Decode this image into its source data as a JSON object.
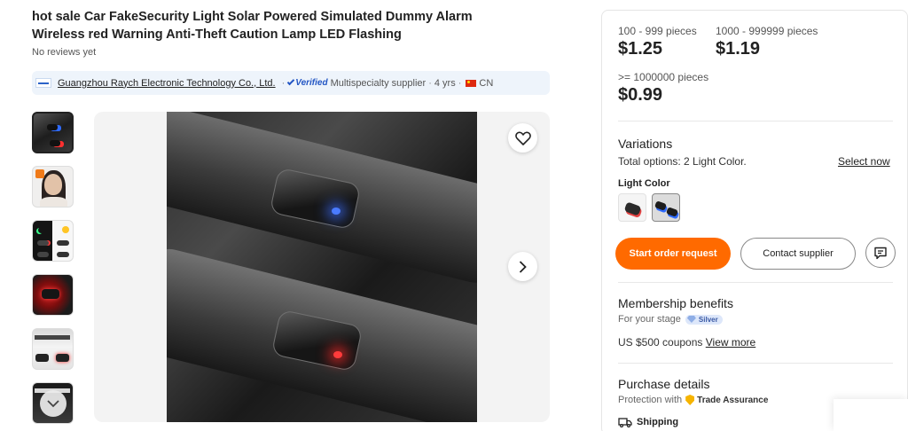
{
  "product": {
    "title": "hot sale Car FakeSecurity Light Solar Powered Simulated Dummy Alarm Wireless red Warning Anti-Theft Caution Lamp LED Flashing",
    "reviews": "No reviews yet"
  },
  "supplier": {
    "name": "Guangzhou Raych Electronic Technology Co., Ltd.",
    "verified": "Verified",
    "type": "Multispecialty supplier",
    "years": "4 yrs",
    "country": "CN"
  },
  "gallery": {
    "thumbnail_count": 6,
    "active_index": 0
  },
  "pricing": {
    "tiers": [
      {
        "qty": "100 - 999 pieces",
        "price": "$1.25"
      },
      {
        "qty": "1000 - 999999 pieces",
        "price": "$1.19"
      },
      {
        "qty": ">= 1000000 pieces",
        "price": "$0.99"
      }
    ]
  },
  "variations": {
    "title": "Variations",
    "total": "Total options: 2 Light Color.",
    "select_label": "Select now",
    "light_color_label": "Light Color"
  },
  "actions": {
    "order": "Start order request",
    "contact": "Contact supplier"
  },
  "membership": {
    "title": "Membership benefits",
    "stage": "For your stage",
    "level": "Silver",
    "coupons": "US $500 coupons",
    "view_more": "View more"
  },
  "purchase": {
    "title": "Purchase details",
    "protection": "Protection with",
    "trade_assurance": "Trade Assurance",
    "shipping": "Shipping"
  },
  "icons": {
    "favorite": "heart-icon",
    "next": "chevron-right-icon",
    "scroll": "chevron-down-icon",
    "chat": "chat-icon",
    "shipping": "truck-icon",
    "shield": "shield-icon"
  },
  "colors": {
    "accent": "#ff6a00",
    "verified": "#2356c4",
    "supplier_bar": "#eef4fb"
  }
}
